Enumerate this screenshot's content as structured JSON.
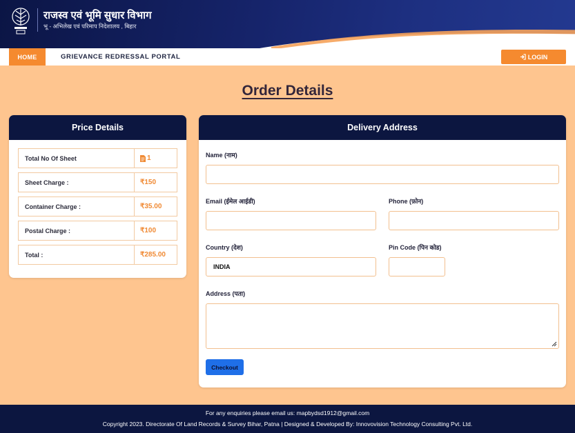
{
  "header": {
    "department_title": "राजस्व एवं भूमि सुधार विभाग",
    "department_subtitle": "भू - अभिलेख एवं परिमाप निदेशालय , बिहार"
  },
  "nav": {
    "home_label": "HOME",
    "portal_label": "GRIEVANCE REDRESSAL PORTAL",
    "login_label": "LOGIN"
  },
  "page": {
    "title": "Order Details"
  },
  "price_details": {
    "heading": "Price Details",
    "rows": [
      {
        "label": "Total No Of Sheet",
        "value": "1",
        "icon": "sheet-icon"
      },
      {
        "label": "Sheet Charge :",
        "value": "₹150"
      },
      {
        "label": "Container Charge :",
        "value": "₹35.00"
      },
      {
        "label": "Postal Charge :",
        "value": "₹100"
      },
      {
        "label": "Total :",
        "value": "₹285.00"
      }
    ]
  },
  "delivery": {
    "heading": "Delivery Address",
    "name_label": "Name (नाम)",
    "name_value": "",
    "email_label": "Email (ईमेल आईडी)",
    "email_value": "",
    "phone_label": "Phone (फ़ोन)",
    "phone_value": "",
    "country_label": "Country (देश)",
    "country_value": "INDIA",
    "pincode_label": "Pin Code (पिन कोड)",
    "pincode_value": "",
    "address_label": "Address (पता)",
    "address_value": "",
    "checkout_label": "Checkout"
  },
  "footer": {
    "line1": "For any enquiries please email us: mapbydsd1912@gmail.com",
    "line2": "Copyright 2023. Directorate Of Land Records & Survey Bihar, Patna | Designed & Developed By: Innovovision Technology Consulting Pvt. Ltd."
  },
  "colors": {
    "page_bg": "#fec58f",
    "navy": "#0c1640",
    "accent_orange": "#f58a2f",
    "checkout_blue": "#1f6fe8"
  }
}
